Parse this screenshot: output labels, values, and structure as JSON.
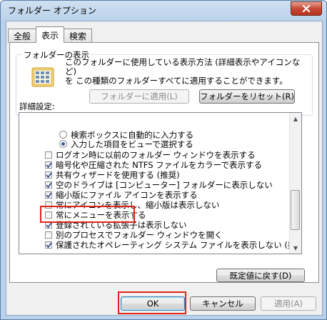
{
  "window": {
    "title": "フォルダー オプション"
  },
  "tabs": [
    {
      "label": "全般",
      "active": false
    },
    {
      "label": "表示",
      "active": true
    },
    {
      "label": "検索",
      "active": false
    }
  ],
  "folder_view": {
    "group_label": "フォルダーの表示",
    "description_line1": "このフォルダーに使用している表示方法 (詳細表示やアイコンなど)",
    "description_line2": "を この種類のフォルダーすべてに適用することができます。",
    "apply_button": "フォルダーに適用(L)",
    "reset_button": "フォルダーをリセット(R)"
  },
  "advanced": {
    "label": "詳細設定:",
    "items": [
      {
        "type": "radio",
        "checked": false,
        "label": "検索ボックスに自動的に入力する"
      },
      {
        "type": "radio",
        "checked": true,
        "label": "入力した項目をビューで選択する"
      },
      {
        "type": "checkbox",
        "checked": false,
        "label": "ログオン時に以前のフォルダー ウィンドウを表示する"
      },
      {
        "type": "checkbox",
        "checked": true,
        "label": "暗号化や圧縮された NTFS ファイルをカラーで表示する"
      },
      {
        "type": "checkbox",
        "checked": true,
        "label": "共有ウィザードを使用する (推奨)"
      },
      {
        "type": "checkbox",
        "checked": true,
        "label": "空のドライブは [コンピューター] フォルダーに表示しない"
      },
      {
        "type": "checkbox",
        "checked": true,
        "label": "縮小版にファイル アイコンを表示する"
      },
      {
        "type": "checkbox",
        "checked": false,
        "label": "常にアイコンを表示し、縮小版は表示しない"
      },
      {
        "type": "checkbox",
        "checked": false,
        "label": "常にメニューを表示する"
      },
      {
        "type": "checkbox",
        "checked": true,
        "label": "登録されている拡張子は表示しない"
      },
      {
        "type": "checkbox",
        "checked": false,
        "label": "別のプロセスでフォルダー ウィンドウを開く"
      },
      {
        "type": "checkbox",
        "checked": true,
        "label": "保護されたオペレーティング システム ファイルを表示しない (推奨)"
      }
    ],
    "restore_defaults_button": "既定値に戻す(D)"
  },
  "dialog_buttons": {
    "ok": "OK",
    "cancel": "キャンセル",
    "apply": "適用(A)"
  },
  "colors": {
    "highlight": "#e0241a",
    "title_bar": "#b9d1ea",
    "close_button": "#c74a36"
  }
}
